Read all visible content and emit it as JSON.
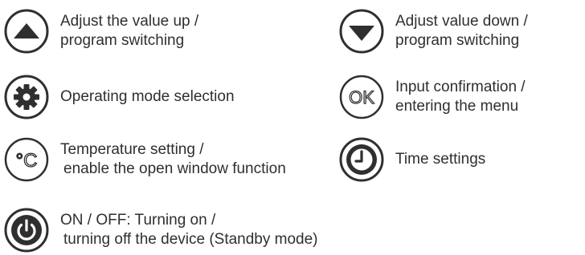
{
  "legend": {
    "up": {
      "icon": "triangle-up-icon",
      "line1": "Adjust the value up /",
      "line2": "program switching"
    },
    "down": {
      "icon": "triangle-down-icon",
      "line1": "Adjust value down /",
      "line2": "program switching"
    },
    "mode": {
      "icon": "gear-icon",
      "line1": "Operating mode selection"
    },
    "ok": {
      "icon": "ok-icon",
      "glyph": "OK",
      "line1": "Input confirmation /",
      "line2": "entering the menu"
    },
    "temp": {
      "icon": "celsius-icon",
      "glyph": "°C",
      "line1": "Temperature setting /",
      "line2": "enable the open window function"
    },
    "time": {
      "icon": "clock-icon",
      "line1": "Time settings"
    },
    "power": {
      "icon": "power-icon",
      "line1": "ON / OFF: Turning on /",
      "line2": "turning off the device (Standby mode)"
    }
  },
  "colors": {
    "icon": "#2f2f2f",
    "text": "#2f2f2f"
  }
}
